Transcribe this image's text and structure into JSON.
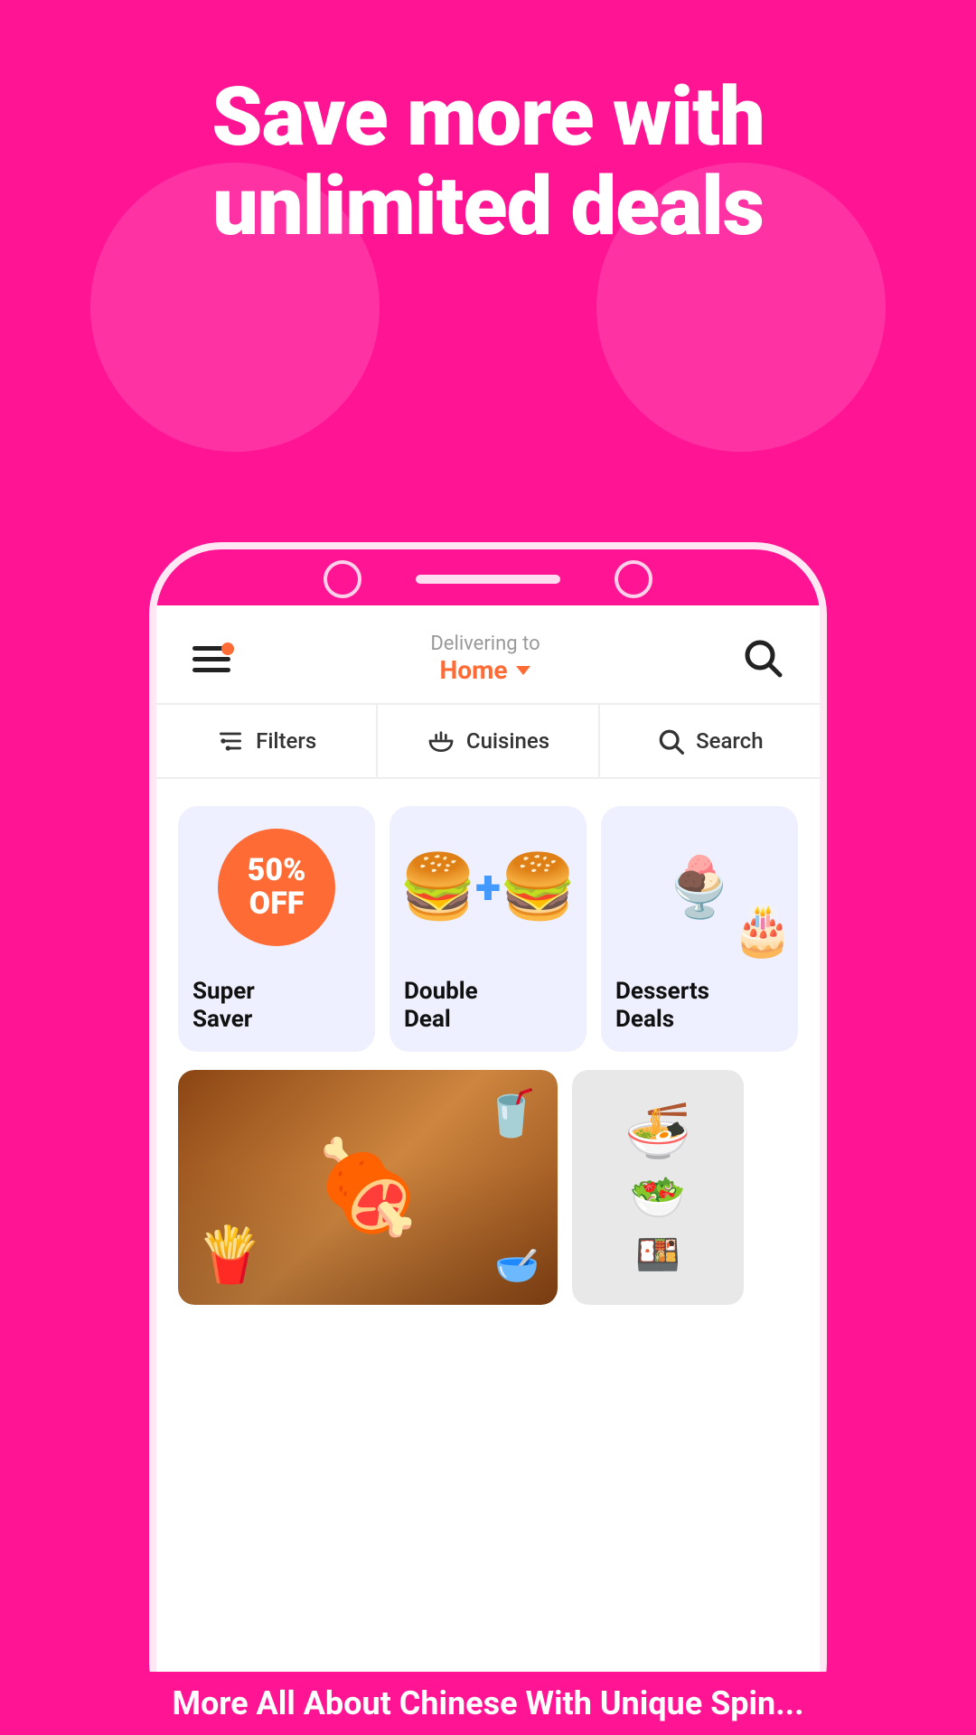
{
  "hero": {
    "title": "Save more with unlimited deals",
    "background_color": "#FF1493"
  },
  "header": {
    "delivery_label": "Delivering to",
    "location": "Home",
    "location_color": "#FF6B35"
  },
  "filter_bar": {
    "items": [
      {
        "id": "filters",
        "label": "Filters",
        "icon": "sliders"
      },
      {
        "id": "cuisines",
        "label": "Cuisines",
        "icon": "bowl"
      },
      {
        "id": "search",
        "label": "Search",
        "icon": "search"
      }
    ]
  },
  "categories": [
    {
      "id": "super-saver",
      "name": "Super\nSaver",
      "discount": "50%\nOFF",
      "type": "discount"
    },
    {
      "id": "double-deal",
      "name": "Double\nDeal",
      "type": "burgers"
    },
    {
      "id": "desserts-deals",
      "name": "Desserts\nDeals",
      "type": "desserts"
    }
  ],
  "bottom_caption": "More All About Chinese With Unique Spin...",
  "colors": {
    "primary": "#FF1493",
    "accent": "#FF6B35",
    "card_bg": "#EEF0FF",
    "text_dark": "#111111",
    "text_gray": "#999999"
  }
}
